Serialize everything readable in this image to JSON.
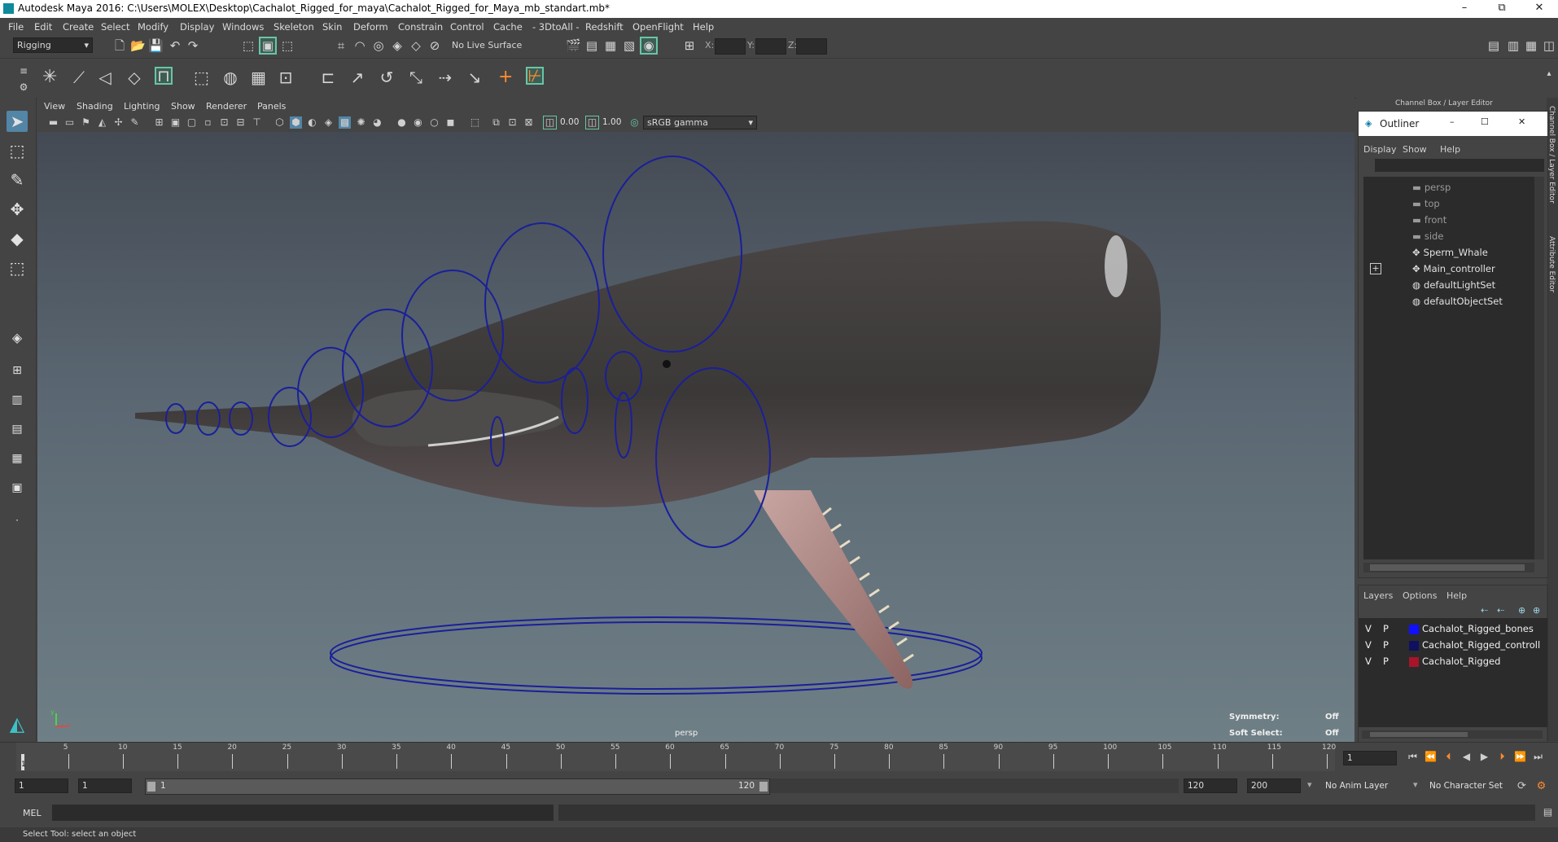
{
  "window": {
    "title": "Autodesk Maya 2016: C:\\Users\\MOLEX\\Desktop\\Cachalot_Rigged_for_maya\\Cachalot_Rigged_for_Maya_mb_standart.mb*",
    "minimize": "–",
    "restore": "⧉",
    "close": "✕"
  },
  "menu": [
    "File",
    "Edit",
    "Create",
    "Select",
    "Modify",
    "Display",
    "Windows",
    "Skeleton",
    "Skin",
    "Deform",
    "Constrain",
    "Control",
    "Cache",
    "- 3DtoAll -",
    "Redshift",
    "OpenFlight",
    "Help"
  ],
  "statusline": {
    "menuset": "Rigging",
    "live_surface": "No Live Surface",
    "x_label": "X:",
    "y_label": "Y:",
    "z_label": "Z:"
  },
  "panel_menu": [
    "View",
    "Shading",
    "Lighting",
    "Show",
    "Renderer",
    "Panels"
  ],
  "panel_toolbar": {
    "exposure": "0.00",
    "gamma": "1.00",
    "color_space": "sRGB gamma"
  },
  "viewport": {
    "camera_label": "persp",
    "hud": [
      {
        "label": "Symmetry:",
        "value": "Off"
      },
      {
        "label": "Soft Select:",
        "value": "Off"
      }
    ],
    "axis_y": "y",
    "axis_x": "x"
  },
  "channel_box_title": "Channel Box / Layer Editor",
  "side_tabs": {
    "channel": "Channel Box / Layer Editor",
    "attribute": "Attribute Editor"
  },
  "outliner": {
    "title": "Outliner",
    "menu": [
      "Display",
      "Show",
      "Help"
    ],
    "items": [
      {
        "label": "persp",
        "dim": true
      },
      {
        "label": "top",
        "dim": true
      },
      {
        "label": "front",
        "dim": true
      },
      {
        "label": "side",
        "dim": true
      },
      {
        "label": "Sperm_Whale",
        "dim": false
      },
      {
        "label": "Main_controller",
        "dim": false
      },
      {
        "label": "defaultLightSet",
        "dim": false
      },
      {
        "label": "defaultObjectSet",
        "dim": false
      }
    ]
  },
  "layers": {
    "menu": [
      "Layers",
      "Options",
      "Help"
    ],
    "rows": [
      {
        "v": "V",
        "p": "P",
        "color": "#1010ff",
        "name": "Cachalot_Rigged_bones"
      },
      {
        "v": "V",
        "p": "P",
        "color": "#101060",
        "name": "Cachalot_Rigged_controll"
      },
      {
        "v": "V",
        "p": "P",
        "color": "#a8142a",
        "name": "Cachalot_Rigged"
      }
    ]
  },
  "timeline": {
    "ticks": [
      "5",
      "10",
      "15",
      "20",
      "25",
      "30",
      "35",
      "40",
      "45",
      "50",
      "55",
      "60",
      "65",
      "70",
      "75",
      "80",
      "85",
      "90",
      "95",
      "100",
      "105",
      "110",
      "115",
      "120"
    ],
    "current_frame": "1",
    "start_marker": "1"
  },
  "range": {
    "start": "1",
    "anim_start": "1",
    "slider_start": "1",
    "slider_end": "120",
    "end": "120",
    "anim_end": "200",
    "anim_layer": "No Anim Layer",
    "character_set": "No Character Set"
  },
  "command": {
    "lang": "MEL"
  },
  "help_line": "Select Tool: select an object",
  "colors": {
    "bg": "#444444",
    "viewport_top": "#444a54",
    "viewport_bottom": "#6f7f86",
    "accent": "#5285a6",
    "controller": "#1a1f9a"
  }
}
